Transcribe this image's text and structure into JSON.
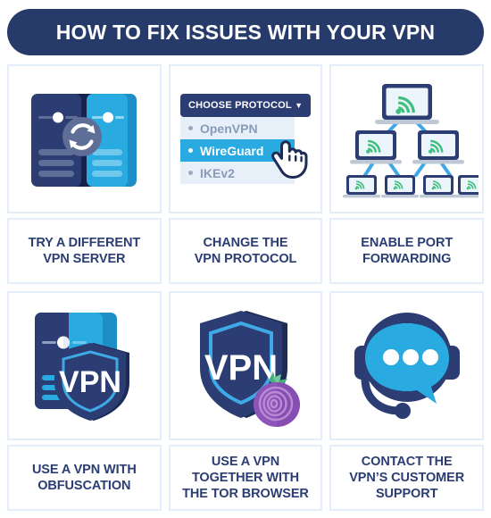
{
  "header": {
    "title": "HOW TO FIX ISSUES WITH YOUR VPN",
    "background_color": "#273B6B",
    "text_color": "#FFFFFF"
  },
  "theme": {
    "navy": "#2B3D72",
    "navy_dark": "#1D2B55",
    "blue": "#29ABE2",
    "blue_dark": "#1E8FC6",
    "light_border": "#E3EEFA",
    "list_bg": "#E7EFF8",
    "gray_blue": "#5E6E96",
    "green": "#3FBF7F",
    "purple": "#8E55B8",
    "page_bg": "#FFFFFF"
  },
  "cards": [
    {
      "id": "try-different-vpn-server",
      "label": "TRY A DIFFERENT\nVPN SERVER",
      "icon": "two-servers-sync-icon"
    },
    {
      "id": "change-vpn-protocol",
      "label": "CHANGE THE\nVPN PROTOCOL",
      "icon": "protocol-dropdown-icon",
      "dropdown": {
        "button_label": "CHOOSE PROTOCOL",
        "chevron": "▼",
        "options": [
          {
            "label": "OpenVPN",
            "selected": false
          },
          {
            "label": "WireGuard",
            "selected": true
          },
          {
            "label": "IKEv2",
            "selected": false
          }
        ]
      }
    },
    {
      "id": "enable-port-forwarding",
      "label": "ENABLE PORT\nFORWARDING",
      "icon": "network-tree-monitors-icon"
    },
    {
      "id": "use-vpn-with-obfuscation",
      "label": "USE A VPN WITH\nOBFUSCATION",
      "icon": "server-with-vpn-shield-icon",
      "shield_text": "VPN"
    },
    {
      "id": "use-vpn-with-tor",
      "label": "USE A VPN\nTOGETHER WITH\nTHE TOR BROWSER",
      "icon": "vpn-shield-tor-onion-icon",
      "shield_text": "VPN"
    },
    {
      "id": "contact-customer-support",
      "label": "CONTACT THE\nVPN’S CUSTOMER\nSUPPORT",
      "icon": "headset-chat-bubble-icon"
    }
  ]
}
